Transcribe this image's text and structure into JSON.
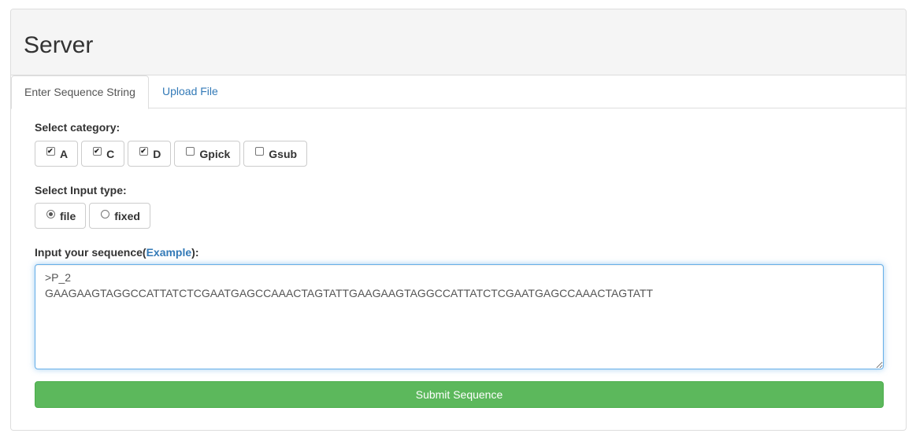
{
  "header": {
    "title": "Server"
  },
  "tabs": [
    {
      "label": "Enter Sequence String",
      "active": true
    },
    {
      "label": "Upload File",
      "active": false
    }
  ],
  "category": {
    "label": "Select category:",
    "options": [
      {
        "label": "A",
        "checked": true
      },
      {
        "label": "C",
        "checked": true
      },
      {
        "label": "D",
        "checked": true
      },
      {
        "label": "Gpick",
        "checked": false
      },
      {
        "label": "Gsub",
        "checked": false
      }
    ]
  },
  "input_type": {
    "label": "Select Input type:",
    "options": [
      {
        "label": "file",
        "checked": true
      },
      {
        "label": "fixed",
        "checked": false
      }
    ]
  },
  "sequence": {
    "label_prefix": "Input your sequence(",
    "example_link": "Example",
    "label_suffix": "):",
    "value": ">P_2\nGAAGAAGTAGGCCATTATCTCGAATGAGCCAAACTAGTATTGAAGAAGTAGGCCATTATCTCGAATGAGCCAAACTAGTATT"
  },
  "submit_label": "Submit Sequence",
  "colors": {
    "submit_bg": "#5cb85c",
    "link": "#337ab7",
    "focus_border": "#66afe9"
  }
}
